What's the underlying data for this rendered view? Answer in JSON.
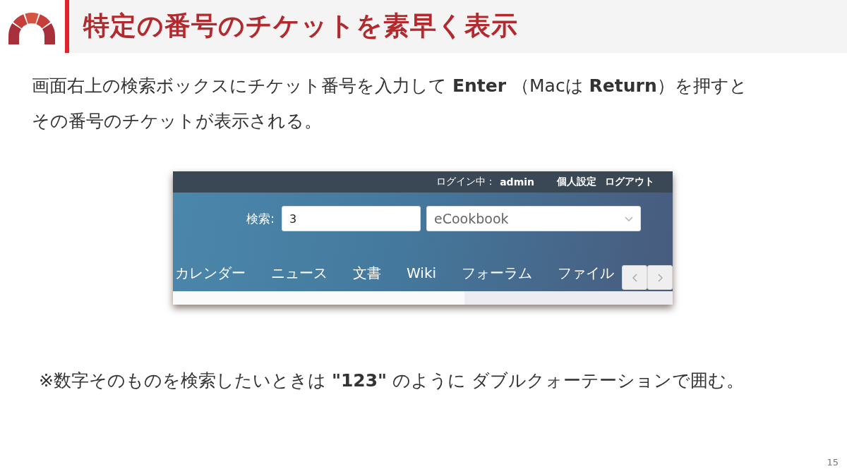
{
  "header": {
    "title": "特定の番号のチケットを素早く表示"
  },
  "intro": {
    "lines": [
      "画面右上の検索ボックスにチケット番号を入力して **Enter** （Macは **Return**）を押すと",
      "その番号のチケットが表示される。"
    ]
  },
  "screenshot": {
    "top_bar": {
      "login_label": "ログイン中：",
      "user": "admin",
      "links": [
        "個人設定",
        "ログアウト"
      ]
    },
    "search": {
      "label": "検索:",
      "value": "3"
    },
    "project_select": {
      "value": "eCookbook"
    },
    "tabs": [
      "カレンダー",
      "ニュース",
      "文書",
      "Wiki",
      "フォーラム",
      "ファイル"
    ]
  },
  "note": "※数字そのものを検索したいときは **\"123\"** のように ダブルクォーテーションで囲む。",
  "page_number": "15"
}
